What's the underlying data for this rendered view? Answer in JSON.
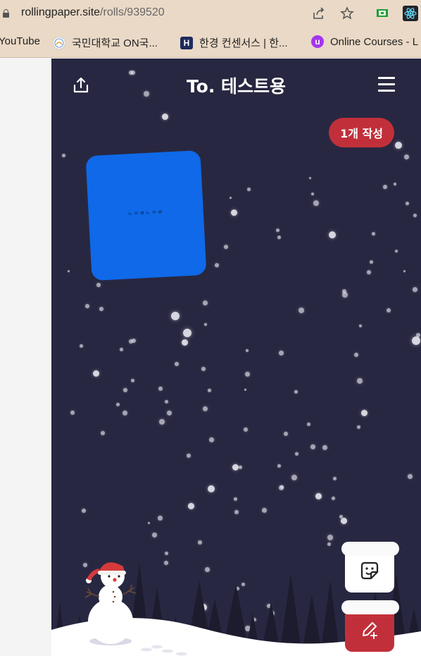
{
  "browser": {
    "url_domain": "rollingpaper.site",
    "url_path": "/rolls/939520",
    "bookmarks": [
      {
        "label": "YouTube"
      },
      {
        "label": "국민대학교 ON국..."
      },
      {
        "label": "한경 컨센서스 | 한..."
      },
      {
        "label": "Online Courses - L"
      }
    ],
    "bookmark_icons": [
      "university-logo",
      "H",
      "u"
    ]
  },
  "header": {
    "title": "To. 테스트용"
  },
  "badge": {
    "label": "1개 작성"
  },
  "note": {
    "text": "ㄴㅇㄹㄴㅇㄹ"
  },
  "colors": {
    "background": "#282741",
    "badge": "#c1303a",
    "note": "#0f69e8",
    "write_button": "#c1303a"
  },
  "icons": [
    "share-icon",
    "menu-icon",
    "sticker-icon",
    "write-icon",
    "snowman-icon",
    "lock-icon",
    "share-page-icon",
    "star-icon",
    "extension-icon",
    "react-icon"
  ]
}
